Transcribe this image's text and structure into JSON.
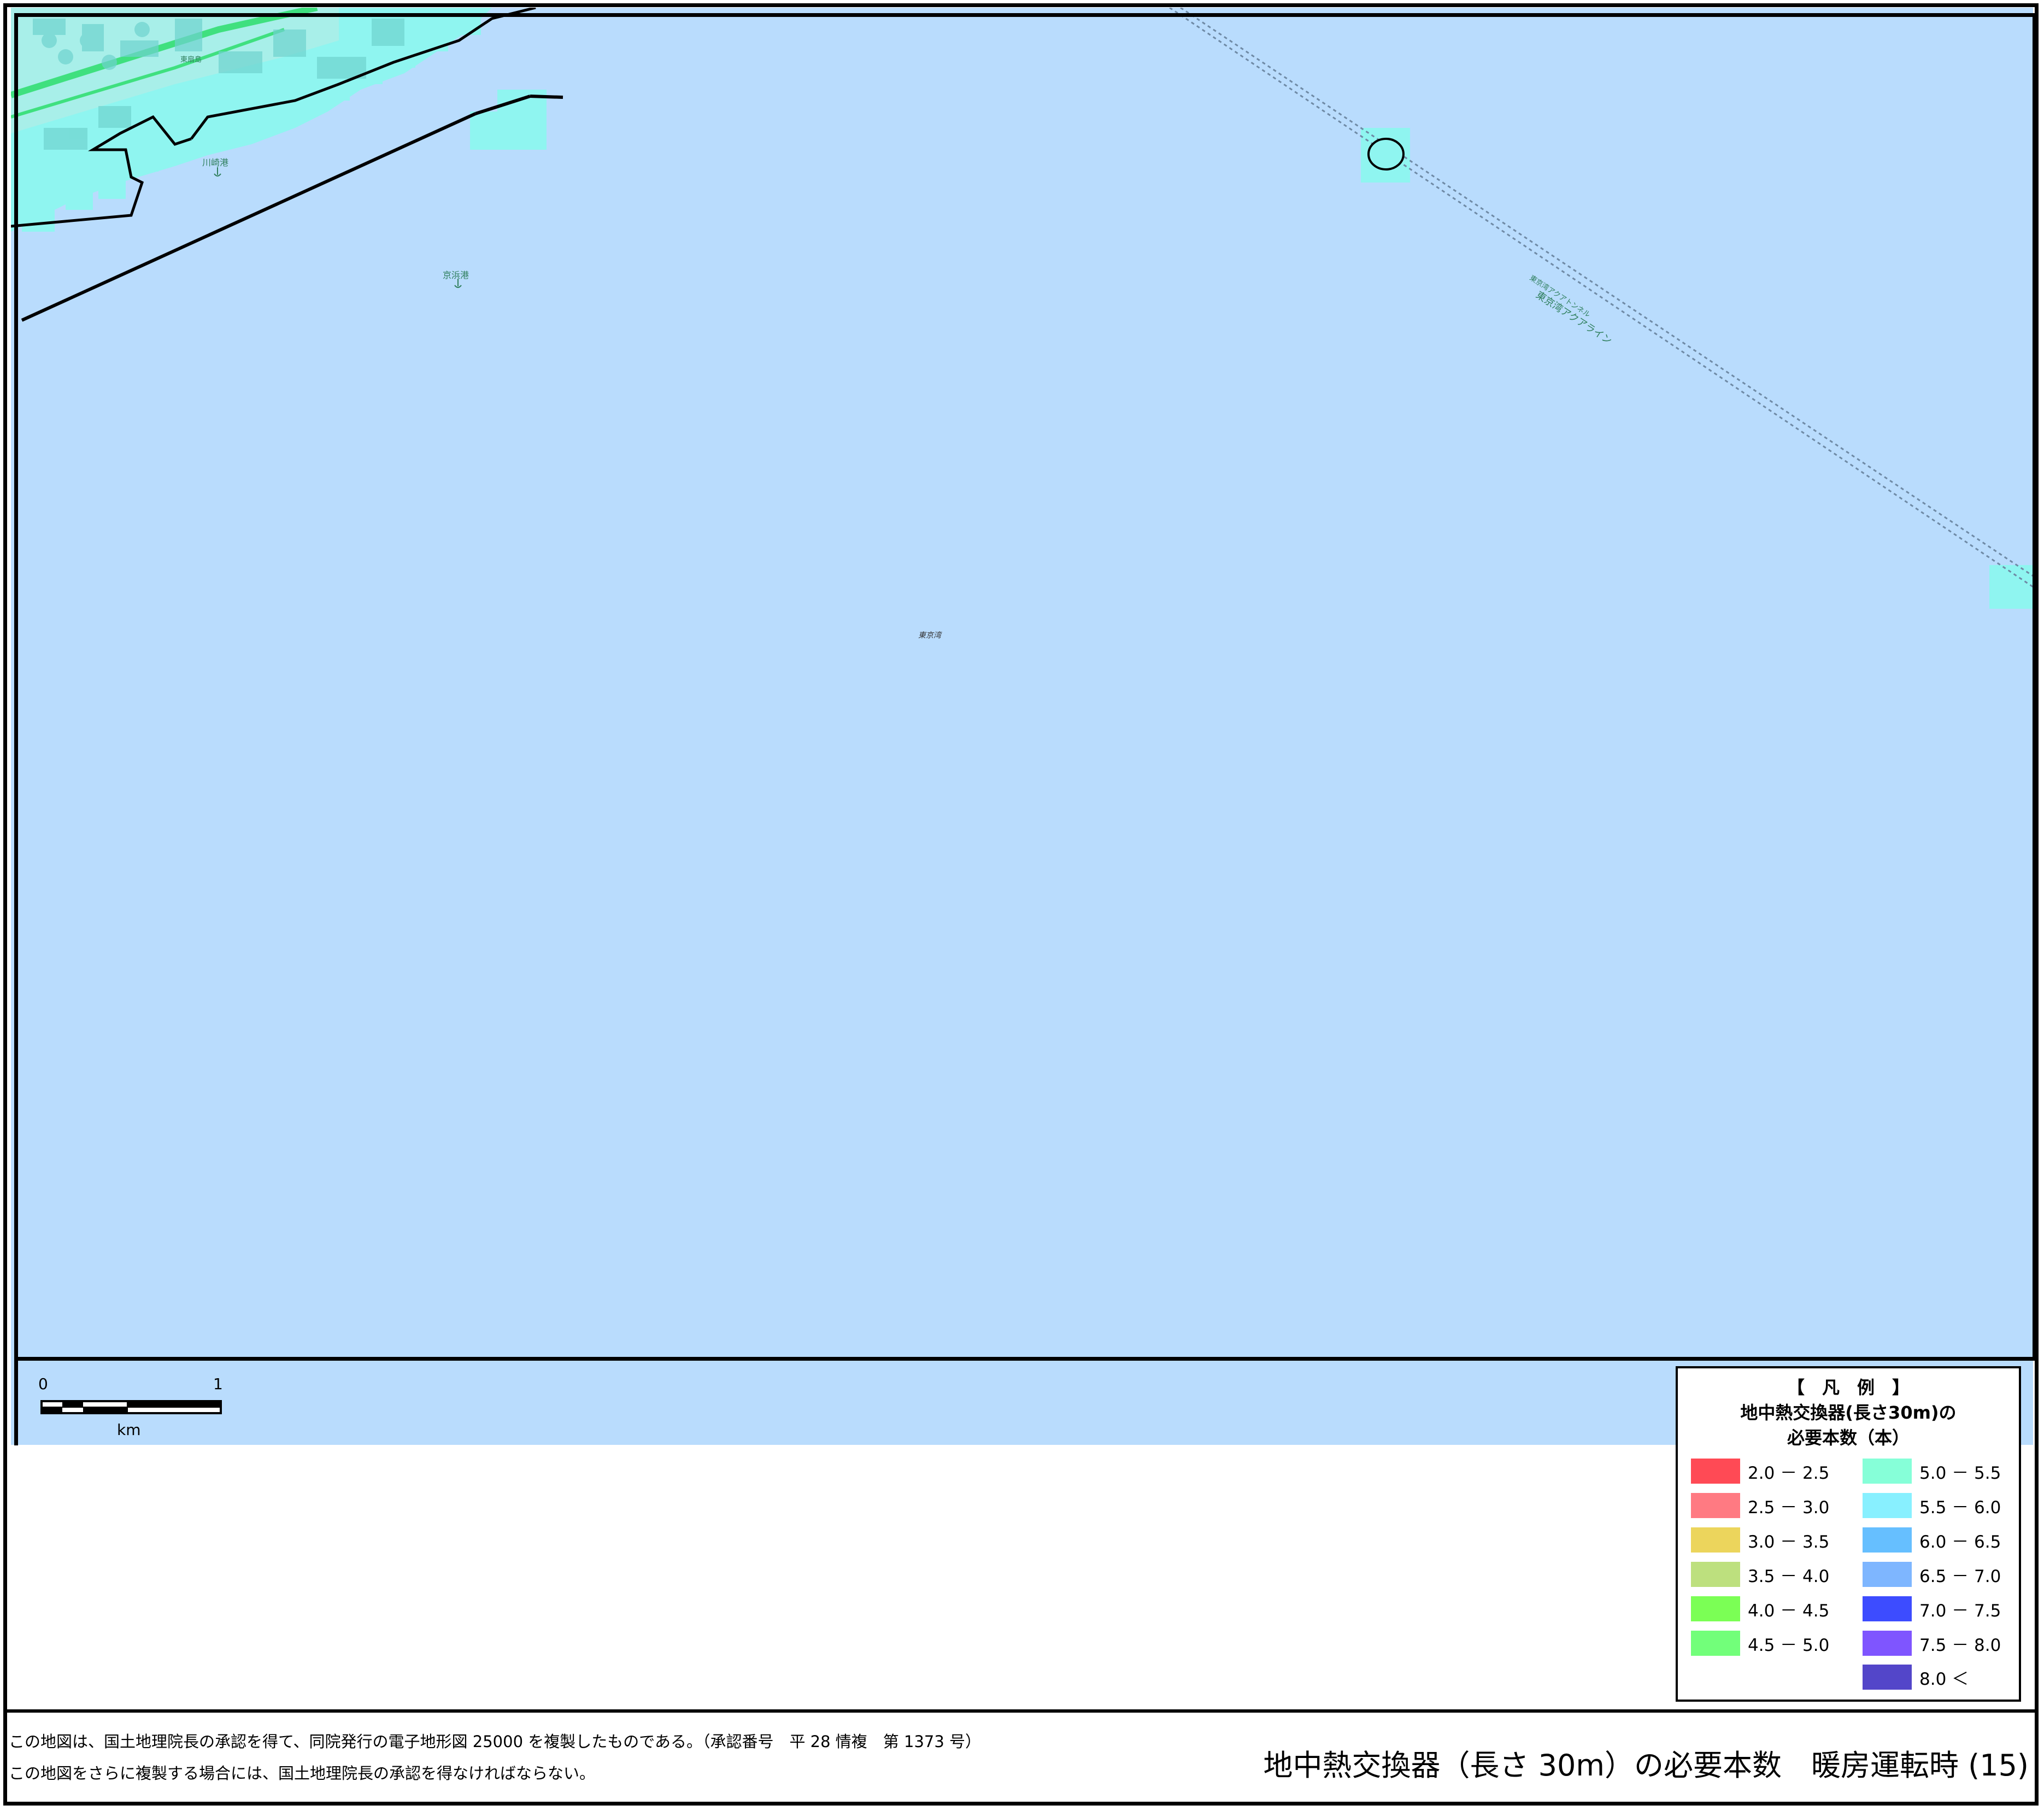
{
  "map": {
    "places": {
      "kawasaki_port": "川崎港",
      "higashi_ogishima": "東扇島",
      "keihin_port": "京浜港",
      "tokyo_bay": "東京湾",
      "aqualine": "東京湾アクアライン",
      "aqualine_tunnel": "東京湾アクアトンネル"
    },
    "colors": {
      "sea": "#b9dcfd",
      "land": "#8ff5f0",
      "road": "#3fe07f",
      "frame": "#000000"
    }
  },
  "scale_bar": {
    "start_label": "0",
    "end_label": "1",
    "unit": "km"
  },
  "legend": {
    "bracket_title": "【　凡　例　】",
    "title_line1": "地中熱交換器(長さ30m)の",
    "title_line2": "必要本数（本）",
    "items": [
      {
        "label": "2.0 － 2.5",
        "color": "#ff4a55"
      },
      {
        "label": "2.5 － 3.0",
        "color": "#ff7a82"
      },
      {
        "label": "3.0 － 3.5",
        "color": "#ecd55c"
      },
      {
        "label": "3.5 － 4.0",
        "color": "#bde07e"
      },
      {
        "label": "4.0 － 4.5",
        "color": "#7bff55"
      },
      {
        "label": "4.5 － 5.0",
        "color": "#72ff7a"
      },
      {
        "label": "5.0 － 5.5",
        "color": "#86ffd8"
      },
      {
        "label": "5.5 － 6.0",
        "color": "#88f0ff"
      },
      {
        "label": "6.0 － 6.5",
        "color": "#66bfff"
      },
      {
        "label": "6.5 － 7.0",
        "color": "#7eb6ff"
      },
      {
        "label": "7.0 － 7.5",
        "color": "#3d4cff"
      },
      {
        "label": "7.5 － 8.0",
        "color": "#7f55ff"
      },
      {
        "label": "8.0 ＜",
        "color": "#5346c9"
      }
    ]
  },
  "footer": {
    "note_line1": "この地図は、国土地理院長の承認を得て、同院発行の電子地形図 25000 を複製したものである。（承認番号　平 28 情複　第 1373 号）",
    "note_line2": "この地図をさらに複製する場合には、国土地理院長の承認を得なければならない。",
    "title": "地中熱交換器（長さ 30m）の必要本数　暖房運転時 (15)"
  }
}
